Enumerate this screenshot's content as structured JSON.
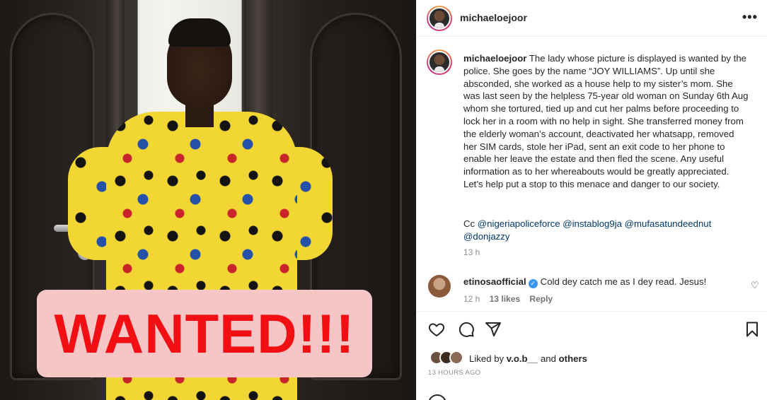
{
  "photo": {
    "banner_text": "WANTED!!!"
  },
  "post": {
    "username": "michaeloejoor",
    "more_icon": "more-horizontal-icon",
    "caption": {
      "username": "michaeloejoor",
      "text": "The lady whose picture is displayed is wanted by the police. She goes by the name “JOY WILLIAMS”. Up until she absconded, she worked as a house help to my sister’s mom. She was last seen by the helpless 75-year old woman on Sunday 6th Aug whom she tortured, tied up and cut her palms before proceeding to lock her in a room with no help in sight.  She transferred money from the elderly woman’s account, deactivated her whatsapp, removed her SIM cards, stole her iPad, sent an exit code to her phone to enable her leave the estate and then fled the scene. Any useful information as to her whereabouts would be greatly appreciated. Let’s help put a stop to this menace and danger to our society.",
      "cc_label": "Cc",
      "mentions": [
        "@nigeriapoliceforce",
        "@instablog9ja",
        "@mufasatundeednut",
        "@donjazzy"
      ],
      "time": "13 h"
    },
    "comment": {
      "username": "etinosaofficial",
      "verified": true,
      "text": "Cold dey catch me as I dey read. Jesus!",
      "time": "12 h",
      "likes": "13 likes",
      "reply": "Reply"
    },
    "actions": {
      "like_icon": "heart-icon",
      "comment_icon": "comment-icon",
      "share_icon": "send-icon",
      "save_icon": "bookmark-icon"
    },
    "likes": {
      "prefix": "Liked by",
      "user": "v.o.b__",
      "joiner": "and",
      "others": "others"
    },
    "posted_ago": "13 HOURS AGO"
  },
  "colors": {
    "mention": "#00376b",
    "muted": "#8e8e8e",
    "wanted_red": "#f20f14",
    "wanted_bg": "#f6c6c6",
    "verified": "#3897f0"
  }
}
